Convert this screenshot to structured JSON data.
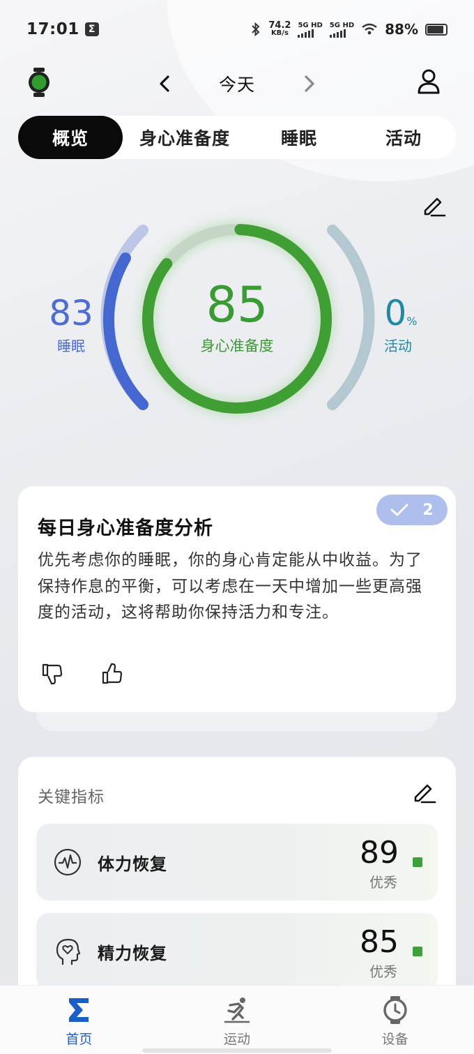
{
  "status_bar": {
    "time": "17:01",
    "network_speed": "74.2",
    "network_unit": "KB/s",
    "signal1": "5G HD",
    "signal2": "5G HD",
    "battery": "88%"
  },
  "header": {
    "date_label": "今天"
  },
  "tabs": [
    {
      "label": "概览",
      "active": true
    },
    {
      "label": "身心准备度",
      "active": false
    },
    {
      "label": "睡眠",
      "active": false
    },
    {
      "label": "活动",
      "active": false
    }
  ],
  "scores": {
    "sleep": {
      "value": "83",
      "label": "睡眠",
      "color": "#4c6bd4"
    },
    "readiness": {
      "value": "85",
      "label": "身心准备度",
      "color": "#3a9a33"
    },
    "activity": {
      "value": "0",
      "unit": "%",
      "label": "活动",
      "color": "#1f8aa3"
    }
  },
  "analysis": {
    "title": "每日身心准备度分析",
    "badge_count": "2",
    "body": "优先考虑你的睡眠，你的身心肯定能从中收益。为了保持作息的平衡，可以考虑在一天中增加一些更高强度的活动，这将帮助你保持活力和专注。"
  },
  "key_metrics": {
    "title": "关键指标",
    "items": [
      {
        "name": "体力恢复",
        "value": "89",
        "level": "优秀",
        "icon": "pulse-icon"
      },
      {
        "name": "精力恢复",
        "value": "85",
        "level": "优秀",
        "icon": "head-heart-icon"
      }
    ]
  },
  "bottom_nav": [
    {
      "label": "首页",
      "icon": "sigma-icon",
      "active": true
    },
    {
      "label": "运动",
      "icon": "runner-icon",
      "active": false
    },
    {
      "label": "设备",
      "icon": "watch-device-icon",
      "active": false
    }
  ]
}
